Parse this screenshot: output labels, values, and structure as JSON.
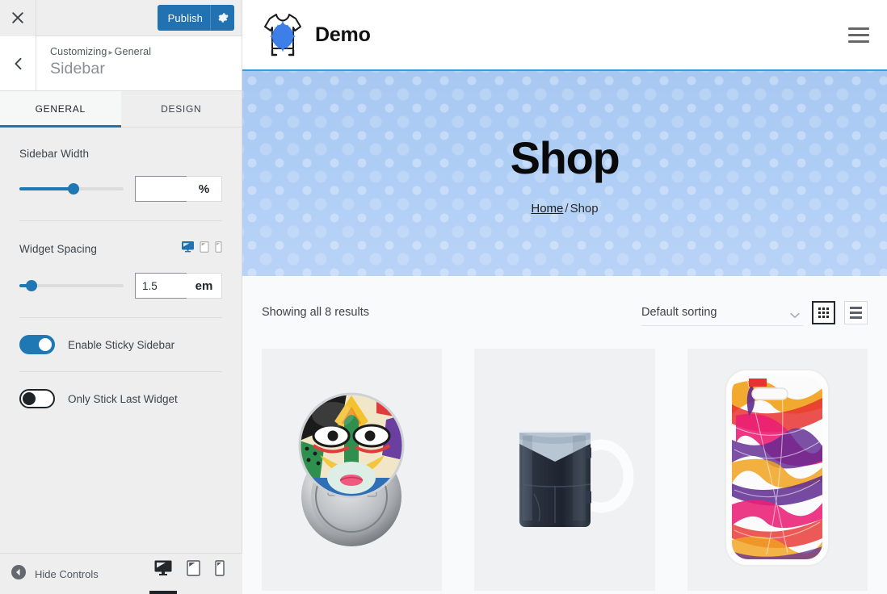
{
  "customizer": {
    "close_icon": "close-icon",
    "publish": {
      "label": "Publish",
      "icon": "gear-icon",
      "color": "#2271b1"
    },
    "back_icon": "chevron-left-icon",
    "breadcrumb": {
      "root": "Customizing",
      "separator": "▸",
      "section": "General"
    },
    "panel_title": "Sidebar",
    "tabs": [
      {
        "id": "general",
        "label": "GENERAL",
        "active": true
      },
      {
        "id": "design",
        "label": "DESIGN",
        "active": false
      }
    ],
    "controls": {
      "sidebar_width": {
        "label": "Sidebar Width",
        "value": "",
        "placeholder": "",
        "unit": "%",
        "slider_percent": 52
      },
      "widget_spacing": {
        "label": "Widget Spacing",
        "value": "1.5",
        "unit": "em",
        "slider_percent": 12,
        "devices": [
          {
            "name": "desktop",
            "active": true
          },
          {
            "name": "tablet",
            "active": false
          },
          {
            "name": "mobile",
            "active": false
          }
        ]
      },
      "enable_sticky_sidebar": {
        "label": "Enable Sticky Sidebar",
        "on": true
      },
      "only_stick_last_widget": {
        "label": "Only Stick Last Widget",
        "on": false
      }
    },
    "footer": {
      "hide_controls_label": "Hide Controls",
      "hide_controls_icon": "collapse-arrow-icon",
      "devices": [
        {
          "name": "desktop",
          "active": true
        },
        {
          "name": "tablet",
          "active": false
        },
        {
          "name": "mobile",
          "active": false
        }
      ]
    }
  },
  "preview": {
    "header": {
      "logo_icon": "tshirt-splatter-logo",
      "site_title": "Demo",
      "menu_icon": "hamburger-menu-icon"
    },
    "hero": {
      "title": "Shop",
      "breadcrumb_home": "Home",
      "breadcrumb_separator": "/",
      "breadcrumb_current": "Shop",
      "bg_color": "#aecdf5",
      "accent_border": "#2f9fe0"
    },
    "shop": {
      "result_count": "Showing all 8 results",
      "sorting": {
        "selected": "Default sorting",
        "chevron_icon": "chevron-down-icon"
      },
      "views": [
        {
          "id": "grid",
          "icon": "grid-view-icon",
          "active": true
        },
        {
          "id": "list",
          "icon": "list-view-icon",
          "active": false
        }
      ],
      "products": [
        {
          "id": "p1",
          "image_alt": "pin-button-face-art"
        },
        {
          "id": "p2",
          "image_alt": "dark-ceramic-mug"
        },
        {
          "id": "p3",
          "image_alt": "abstract-paint-phone-case"
        }
      ]
    }
  }
}
